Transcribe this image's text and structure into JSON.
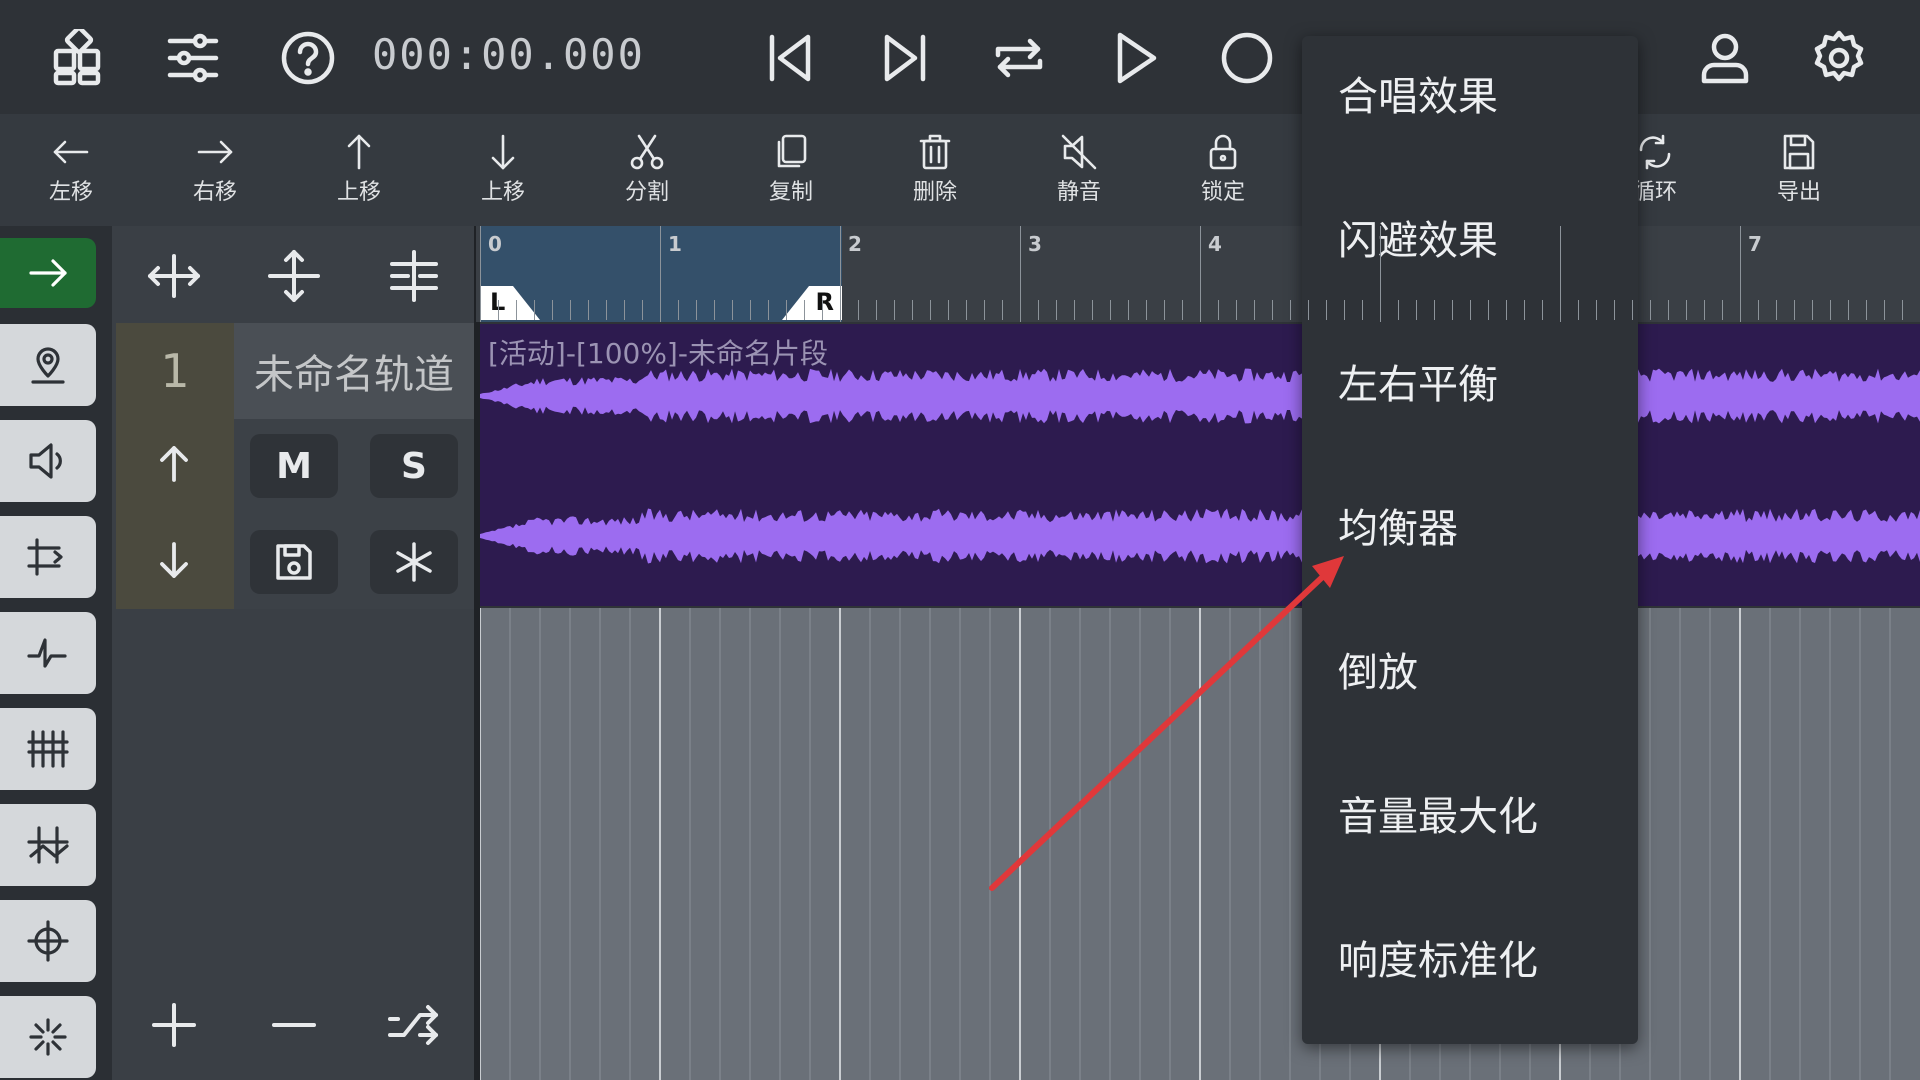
{
  "topbar": {
    "timecode": "000:00.000"
  },
  "toolbar": {
    "items": [
      {
        "label": "左移",
        "icon": "arrow-left-icon"
      },
      {
        "label": "右移",
        "icon": "arrow-right-icon"
      },
      {
        "label": "上移",
        "icon": "arrow-up-icon"
      },
      {
        "label": "上移",
        "icon": "arrow-down-icon"
      },
      {
        "label": "分割",
        "icon": "scissors-icon"
      },
      {
        "label": "复制",
        "icon": "copy-icon"
      },
      {
        "label": "删除",
        "icon": "trash-icon"
      },
      {
        "label": "静音",
        "icon": "mute-icon"
      },
      {
        "label": "锁定",
        "icon": "lock-icon"
      },
      {
        "label": "循环",
        "icon": "loop-icon"
      },
      {
        "label": "导出",
        "icon": "save-icon"
      }
    ]
  },
  "track": {
    "number": "1",
    "name": "未命名轨道",
    "mute_label": "M",
    "solo_label": "S"
  },
  "timeline": {
    "ruler_labels": [
      "0",
      "1",
      "2",
      "3",
      "4",
      "7"
    ],
    "loop_left": "L",
    "loop_right": "R",
    "clip_title": "[活动]-[100%]-未命名片段"
  },
  "menu": {
    "items": [
      "合唱效果",
      "闪避效果",
      "左右平衡",
      "均衡器",
      "倒放",
      "音量最大化",
      "响度标准化"
    ]
  },
  "colors": {
    "accent_green": "#1f6b32",
    "waveform": "#9c6cf0",
    "clip_bg": "#2d1b4f",
    "annotation_arrow": "#e0383a"
  }
}
